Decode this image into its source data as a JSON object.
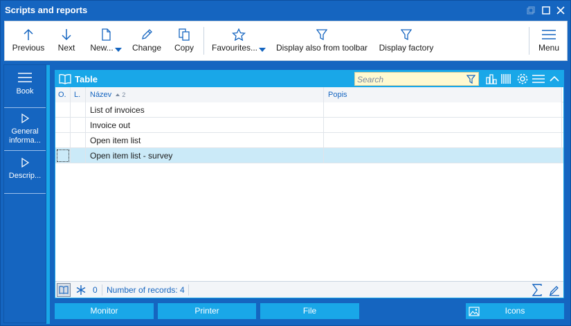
{
  "window": {
    "title": "Scripts and reports"
  },
  "toolbar": {
    "previous": "Previous",
    "next": "Next",
    "new": "New...",
    "change": "Change",
    "copy": "Copy",
    "favourites": "Favourites...",
    "display_from_toolbar": "Display also from toolbar",
    "display_factory": "Display factory",
    "menu": "Menu"
  },
  "sidebar": {
    "items": [
      {
        "label": "Book"
      },
      {
        "label": "General informa..."
      },
      {
        "label": "Descrip..."
      }
    ]
  },
  "panel": {
    "title": "Table",
    "search_placeholder": "Search"
  },
  "table": {
    "columns": {
      "o": "O.",
      "l": "L.",
      "nazev": "Název",
      "sort_index": "2",
      "popis": "Popis"
    },
    "rows": [
      {
        "nazev": "List of invoices",
        "popis": ""
      },
      {
        "nazev": "Invoice out",
        "popis": ""
      },
      {
        "nazev": "Open item list",
        "popis": ""
      },
      {
        "nazev": "Open item list - survey",
        "popis": ""
      }
    ],
    "selected_row": 3
  },
  "status": {
    "filter_count": "0",
    "records": "Number of records: 4"
  },
  "bottom_buttons": {
    "monitor": "Monitor",
    "printer": "Printer",
    "file": "File",
    "icons": "Icons"
  },
  "colors": {
    "primary": "#1565c0",
    "accent": "#19a7e8",
    "selection": "#cbeaf8",
    "search_bg": "#fff9d0"
  }
}
